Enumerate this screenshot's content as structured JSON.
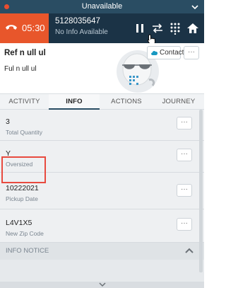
{
  "status": {
    "label": "Unavailable",
    "dot_color": "#e84d2f"
  },
  "call": {
    "timer": "05:30",
    "number": "5128035647",
    "info": "No Info Available",
    "controls": [
      "pause-icon",
      "transfer-icon",
      "keypad-icon",
      "home-icon"
    ]
  },
  "contact": {
    "name": "Ref n ull ul",
    "subtitle": "Ful n ull ul",
    "button_label": "Contact",
    "more_label": "···"
  },
  "tabs": [
    "ACTIVITY",
    "INFO",
    "ACTIONS",
    "JOURNEY"
  ],
  "active_tab": "INFO",
  "info_items": [
    {
      "value": "3",
      "label": "Total Quantity"
    },
    {
      "value": "Y",
      "label": "Oversized"
    },
    {
      "value": "10222021",
      "label": "Pickup Date"
    },
    {
      "value": "L4V1X5",
      "label": "New Zip Code"
    }
  ],
  "item_more_label": "···",
  "notice": {
    "label": "INFO NOTICE"
  },
  "colors": {
    "accent": "#e8562b",
    "call_bar": "#1b3346",
    "status_bar": "#2a4d63",
    "highlight": "#e84a3f"
  }
}
